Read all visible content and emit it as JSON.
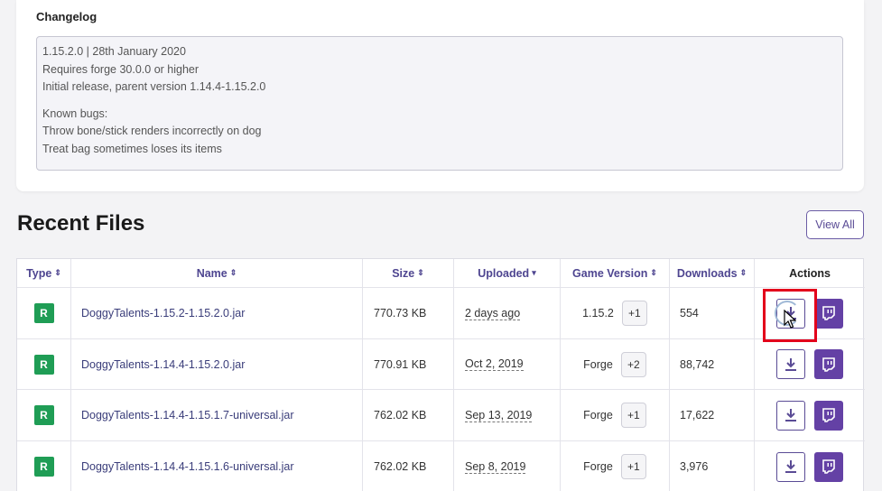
{
  "changelog": {
    "title": "Changelog",
    "lines": [
      "1.15.2.0 | 28th January 2020",
      "Requires forge 30.0.0 or higher",
      "Initial release, parent version 1.14.4-1.15.2.0",
      "Known bugs:",
      "Throw bone/stick renders incorrectly on dog",
      "Treat bag sometimes loses its items"
    ]
  },
  "recent_files": {
    "title": "Recent Files",
    "view_all_label": "View All",
    "columns": {
      "type": "Type",
      "name": "Name",
      "size": "Size",
      "uploaded": "Uploaded",
      "game_version": "Game Version",
      "downloads": "Downloads",
      "actions": "Actions"
    },
    "rows": [
      {
        "type": "R",
        "name": "DoggyTalents-1.15.2-1.15.2.0.jar",
        "size": "770.73 KB",
        "uploaded": "2 days ago",
        "game_version": "1.15.2",
        "extra": "+1",
        "downloads": "554"
      },
      {
        "type": "R",
        "name": "DoggyTalents-1.14.4-1.15.2.0.jar",
        "size": "770.91 KB",
        "uploaded": "Oct 2, 2019",
        "game_version": "Forge",
        "extra": "+2",
        "downloads": "88,742"
      },
      {
        "type": "R",
        "name": "DoggyTalents-1.14.4-1.15.1.7-universal.jar",
        "size": "762.02 KB",
        "uploaded": "Sep 13, 2019",
        "game_version": "Forge",
        "extra": "+1",
        "downloads": "17,622"
      },
      {
        "type": "R",
        "name": "DoggyTalents-1.14.4-1.15.1.6-universal.jar",
        "size": "762.02 KB",
        "uploaded": "Sep 8, 2019",
        "game_version": "Forge",
        "extra": "+1",
        "downloads": "3,976"
      }
    ]
  },
  "colors": {
    "release_badge": "#1f9d55",
    "accent": "#5a4b95",
    "twitch": "#6441a5",
    "highlight": "#e3001b"
  },
  "icons": {
    "download": "download-icon",
    "twitch": "twitch-icon",
    "sort": "sort-icon"
  }
}
